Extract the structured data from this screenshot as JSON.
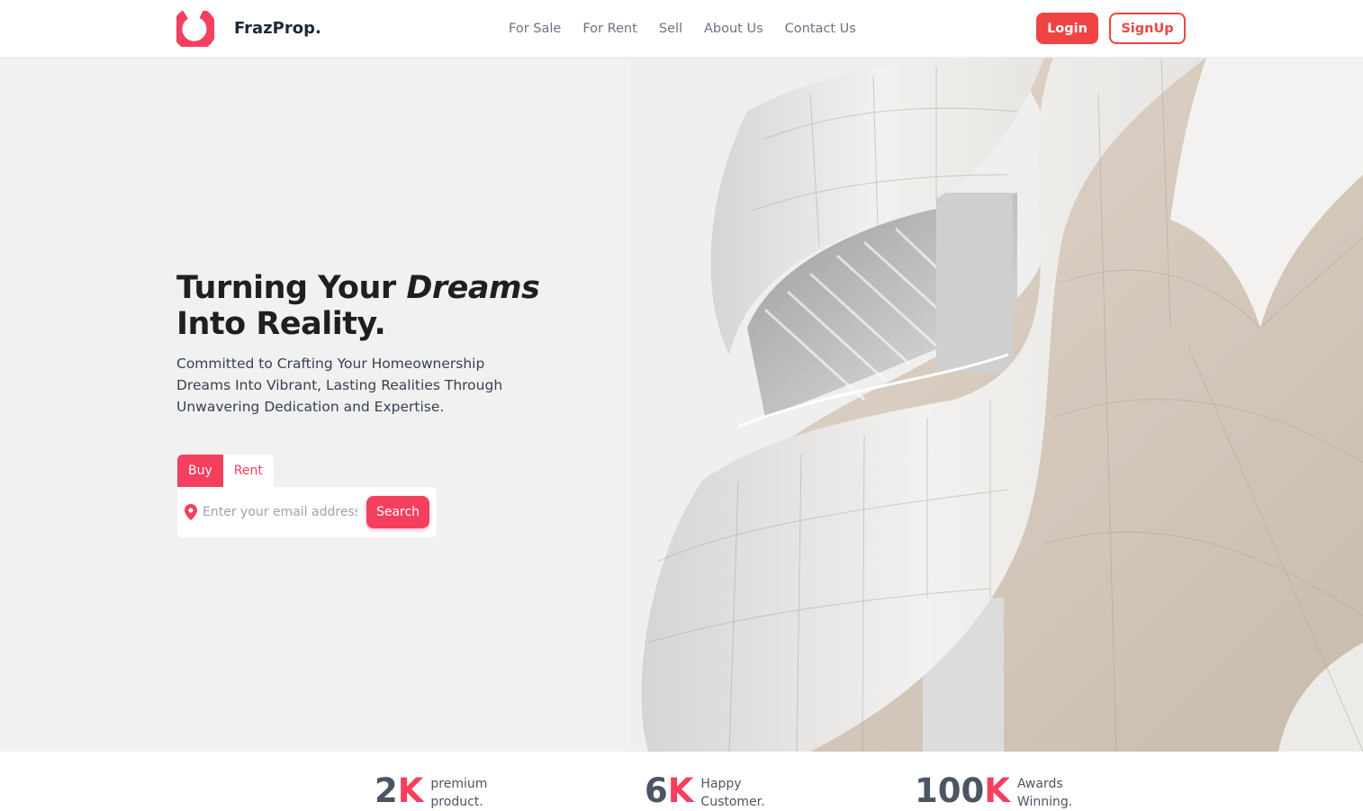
{
  "brand": {
    "name": "FrazProp.",
    "accent": "#f43f5e"
  },
  "nav": {
    "links": [
      "For Sale",
      "For Rent",
      "Sell",
      "About Us",
      "Contact Us"
    ]
  },
  "auth": {
    "login": "Login",
    "signup": "SignUp"
  },
  "hero": {
    "title_prefix": "Turning Your ",
    "title_emphasis": "Dreams",
    "title_line2": "Into Reality.",
    "subtitle": "Committed to Crafting Your Homeownership Dreams Into Vibrant, Lasting Realities Through Unwavering Dedication and Expertise."
  },
  "search": {
    "tabs": [
      "Buy",
      "Rent"
    ],
    "active_tab": "Buy",
    "placeholder": "Enter your email address",
    "button": "Search",
    "icon": "location-pin-icon"
  },
  "stats": [
    {
      "number": "2",
      "suffix": "K",
      "label": "premium product."
    },
    {
      "number": "6",
      "suffix": "K",
      "label": "Happy Customer."
    },
    {
      "number": "100",
      "suffix": "K",
      "label": "Awards Winning."
    }
  ]
}
